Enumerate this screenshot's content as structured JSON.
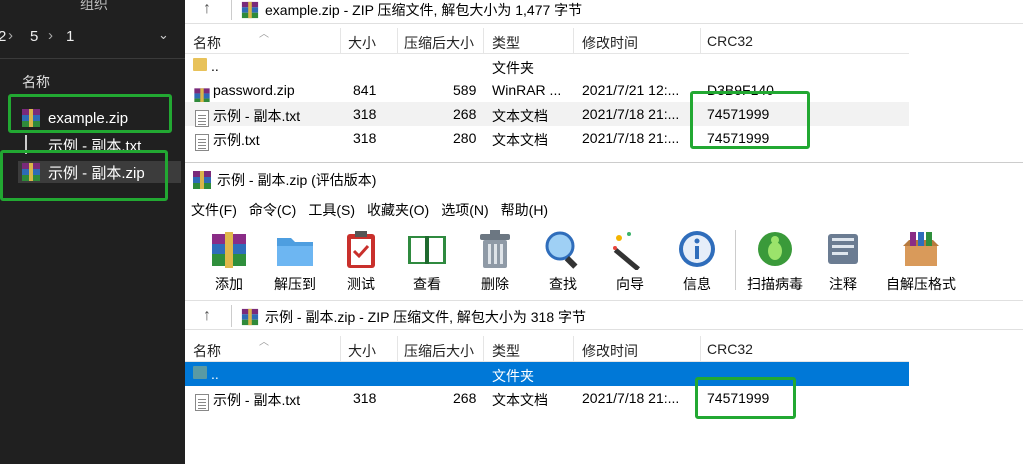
{
  "explorer": {
    "top_label": "组织",
    "crumbs": [
      "2",
      "5",
      "1"
    ],
    "column_name": "名称",
    "items": [
      {
        "name": "example.zip",
        "type": "zip"
      },
      {
        "name": "示例 - 副本.txt",
        "type": "txt"
      },
      {
        "name": "示例 - 副本.zip",
        "type": "zip"
      }
    ]
  },
  "win1": {
    "path": "example.zip - ZIP 压缩文件, 解包大小为 1,477 字节",
    "columns": [
      "名称",
      "大小",
      "压缩后大小",
      "类型",
      "修改时间",
      "CRC32"
    ],
    "rows": [
      {
        "name": "..",
        "size": "",
        "packed": "",
        "type": "文件夹",
        "mtime": "",
        "crc": ""
      },
      {
        "name": "password.zip",
        "size": "841",
        "packed": "589",
        "type": "WinRAR ...",
        "mtime": "2021/7/21 12:...",
        "crc": "D3B9F140"
      },
      {
        "name": "示例 - 副本.txt",
        "size": "318",
        "packed": "268",
        "type": "文本文档",
        "mtime": "2021/7/18 21:...",
        "crc": "74571999"
      },
      {
        "name": "示例.txt",
        "size": "318",
        "packed": "280",
        "type": "文本文档",
        "mtime": "2021/7/18 21:...",
        "crc": "74571999"
      }
    ]
  },
  "win2": {
    "title": "示例 - 副本.zip (评估版本)",
    "menu": [
      "文件(F)",
      "命令(C)",
      "工具(S)",
      "收藏夹(O)",
      "选项(N)",
      "帮助(H)"
    ],
    "toolbar": [
      "添加",
      "解压到",
      "测试",
      "查看",
      "删除",
      "查找",
      "向导",
      "信息",
      "扫描病毒",
      "注释",
      "自解压格式"
    ],
    "path": "示例 - 副本.zip - ZIP 压缩文件, 解包大小为 318 字节",
    "columns": [
      "名称",
      "大小",
      "压缩后大小",
      "类型",
      "修改时间",
      "CRC32"
    ],
    "rows": [
      {
        "name": "..",
        "size": "",
        "packed": "",
        "type": "文件夹",
        "mtime": "",
        "crc": ""
      },
      {
        "name": "示例 - 副本.txt",
        "size": "318",
        "packed": "268",
        "type": "文本文档",
        "mtime": "2021/7/18 21:...",
        "crc": "74571999"
      }
    ]
  },
  "colors": {
    "highlight": "#22a832",
    "selection": "#0078d7",
    "explorer_bg": "#202020"
  }
}
